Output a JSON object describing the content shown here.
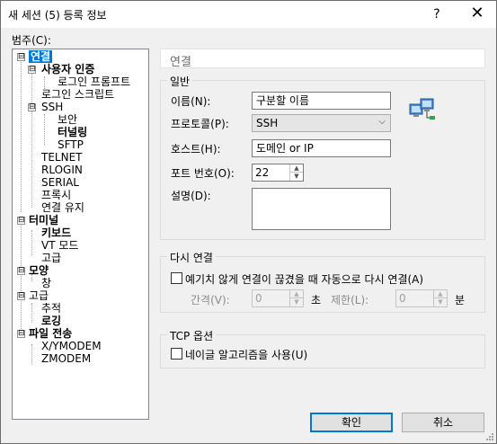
{
  "window": {
    "title": "새 세션 (5) 등록 정보",
    "help": "?",
    "close": "✕"
  },
  "category_label": "범주(C):",
  "tree": {
    "expanded": "⊟",
    "items": [
      {
        "label": "연결",
        "selected": true,
        "bold": true
      },
      {
        "label": "사용자 인증",
        "bold": true
      },
      {
        "label": "로그인 프롬프트"
      },
      {
        "label": "로그인 스크립트"
      },
      {
        "label": "SSH"
      },
      {
        "label": "보안"
      },
      {
        "label": "터널링",
        "bold": true
      },
      {
        "label": "SFTP"
      },
      {
        "label": "TELNET"
      },
      {
        "label": "RLOGIN"
      },
      {
        "label": "SERIAL"
      },
      {
        "label": "프록시"
      },
      {
        "label": "연결 유지"
      },
      {
        "label": "터미널",
        "bold": true
      },
      {
        "label": "키보드",
        "bold": true
      },
      {
        "label": "VT 모드"
      },
      {
        "label": "고급"
      },
      {
        "label": "모양",
        "bold": true
      },
      {
        "label": "창"
      },
      {
        "label": "고급"
      },
      {
        "label": "추적"
      },
      {
        "label": "로깅",
        "bold": true
      },
      {
        "label": "파일 전송",
        "bold": true
      },
      {
        "label": "X/YMODEM"
      },
      {
        "label": "ZMODEM"
      }
    ]
  },
  "panel": {
    "title": "연결",
    "general": {
      "label": "일반",
      "name_label": "이름(N):",
      "name_value": "구분할 이름",
      "protocol_label": "프로토콜(P):",
      "protocol_value": "SSH",
      "host_label": "호스트(H):",
      "host_value": "도메인 or IP",
      "port_label": "포트 번호(O):",
      "port_value": "22",
      "desc_label": "설명(D):",
      "desc_value": ""
    },
    "reconnect": {
      "label": "다시 연결",
      "checkbox_label": "예기치 않게 연결이 끊겼을 때 자동으로 다시 연결(A)",
      "checked": false,
      "interval_label": "간격(V):",
      "interval_value": "0",
      "interval_unit": "초",
      "limit_label": "제한(L):",
      "limit_value": "0",
      "limit_unit": "분"
    },
    "tcp": {
      "label": "TCP 옵션",
      "nagle_label": "네이글 알고리즘을 사용(U)",
      "checked": false
    }
  },
  "buttons": {
    "ok": "확인",
    "cancel": "취소"
  },
  "icons": {
    "network": "network-computers-icon",
    "spin_up": "▲",
    "spin_down": "▼",
    "dropdown": "⌵"
  }
}
